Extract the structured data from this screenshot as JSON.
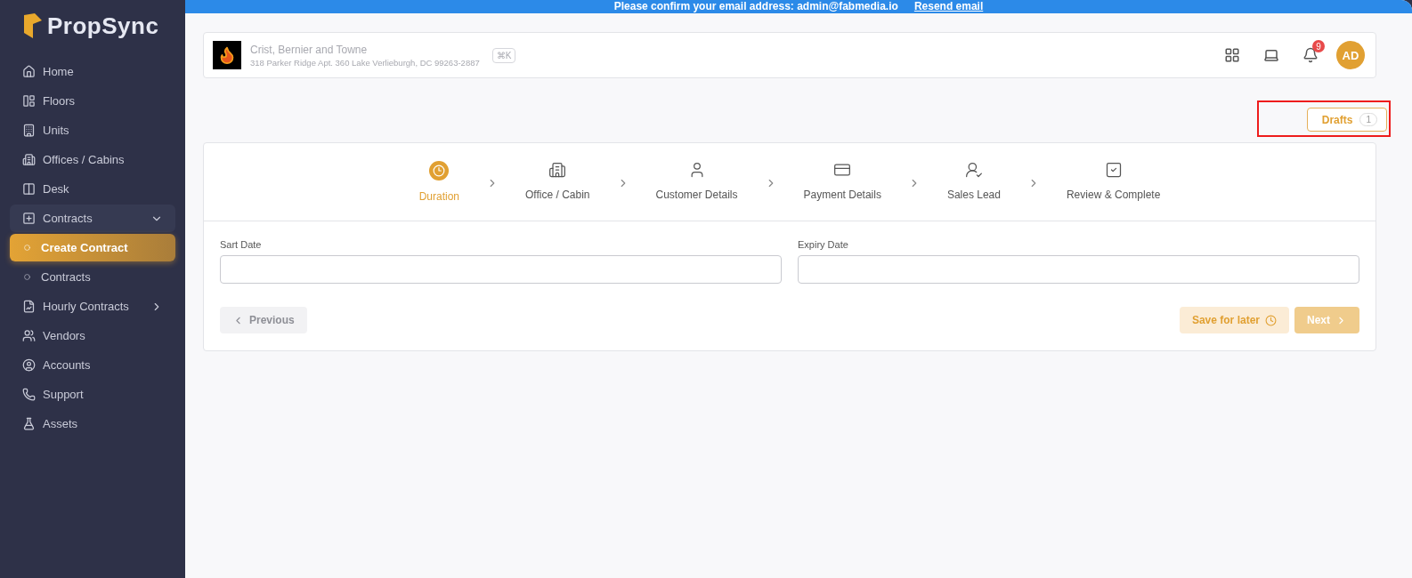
{
  "sidebar": {
    "logo": "PropSync",
    "items": [
      {
        "label": "Home",
        "kind": "item",
        "selected": false
      },
      {
        "label": "Floors",
        "kind": "item",
        "selected": false
      },
      {
        "label": "Units",
        "kind": "item",
        "selected": false
      },
      {
        "label": "Offices / Cabins",
        "kind": "item",
        "selected": false
      },
      {
        "label": "Desk",
        "kind": "item",
        "selected": false
      },
      {
        "label": "Contracts",
        "kind": "group",
        "expanded": true,
        "children": [
          {
            "label": "Create Contract",
            "selected": true
          },
          {
            "label": "Contracts",
            "selected": false
          }
        ]
      },
      {
        "label": "Hourly Contracts",
        "kind": "group",
        "expanded": false
      },
      {
        "label": "Vendors",
        "kind": "item",
        "selected": false
      },
      {
        "label": "Accounts",
        "kind": "item",
        "selected": false
      },
      {
        "label": "Support",
        "kind": "item",
        "selected": false
      },
      {
        "label": "Assets",
        "kind": "item",
        "selected": false
      }
    ]
  },
  "banner": {
    "text": "Please confirm your email address: admin@fabmedia.io",
    "link": "Resend email"
  },
  "header": {
    "company": "Crist, Bernier and Towne",
    "address": "318 Parker Ridge Apt. 360 Lake Verlieburgh, DC 99263-2887",
    "shortcut": "⌘K",
    "notifications": "9",
    "avatar": "AD"
  },
  "drafts": {
    "label": "Drafts",
    "count": "1",
    "highlighted": true
  },
  "steps": [
    {
      "label": "Duration",
      "selected": true
    },
    {
      "label": "Office / Cabin",
      "selected": false
    },
    {
      "label": "Customer Details",
      "selected": false
    },
    {
      "label": "Payment Details",
      "selected": false
    },
    {
      "label": "Sales Lead",
      "selected": false
    },
    {
      "label": "Review & Complete",
      "selected": false
    }
  ],
  "fields": [
    {
      "label": "Sart Date"
    },
    {
      "label": "Expiry Date"
    }
  ],
  "buttons": {
    "previous": "Previous",
    "save": "Save for later",
    "next": "Next"
  }
}
